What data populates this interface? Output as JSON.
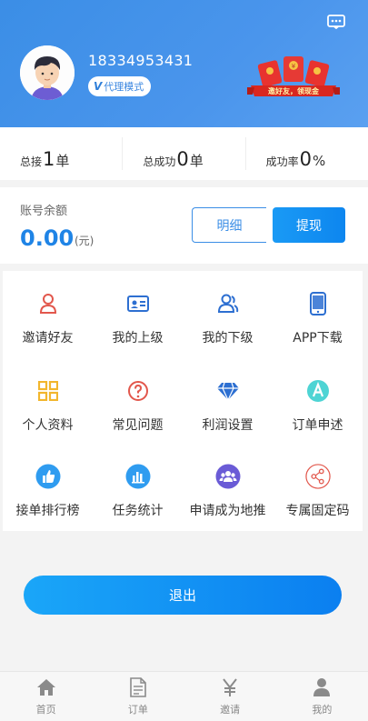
{
  "header": {
    "phone": "18334953431",
    "badge_prefix": "V",
    "badge_label": "代理模式",
    "promo_text": "邀好友，领现金"
  },
  "stats": [
    {
      "label": "总接",
      "value": "1",
      "unit": "单"
    },
    {
      "label": "总成功",
      "value": "0",
      "unit": "单"
    },
    {
      "label": "成功率",
      "value": "0",
      "unit": "%"
    }
  ],
  "balance": {
    "label": "账号余额",
    "amount": "0.00",
    "unit": "(元)",
    "detail_label": "明细",
    "withdraw_label": "提现"
  },
  "menu": [
    {
      "label": "邀请好友",
      "icon": "invite-user-icon"
    },
    {
      "label": "我的上级",
      "icon": "id-card-icon"
    },
    {
      "label": "我的下级",
      "icon": "users-icon"
    },
    {
      "label": "APP下载",
      "icon": "phone-icon"
    },
    {
      "label": "个人资料",
      "icon": "grid-icon"
    },
    {
      "label": "常见问题",
      "icon": "question-icon"
    },
    {
      "label": "利润设置",
      "icon": "diamond-icon"
    },
    {
      "label": "订单申述",
      "icon": "appeal-icon"
    },
    {
      "label": "接单排行榜",
      "icon": "thumbs-up-icon"
    },
    {
      "label": "任务统计",
      "icon": "bar-chart-icon"
    },
    {
      "label": "申请成为地推",
      "icon": "group-icon"
    },
    {
      "label": "专属固定码",
      "icon": "share-icon"
    }
  ],
  "logout_label": "退出",
  "tabs": [
    {
      "label": "首页",
      "icon": "home-icon"
    },
    {
      "label": "订单",
      "icon": "document-icon"
    },
    {
      "label": "邀请",
      "icon": "yen-icon"
    },
    {
      "label": "我的",
      "icon": "person-icon"
    }
  ],
  "colors": {
    "primary": "#1f84e6",
    "header_bg": "#4a95ec",
    "button_gradient_start": "#1aa6f8",
    "button_gradient_end": "#0b7ff0"
  }
}
